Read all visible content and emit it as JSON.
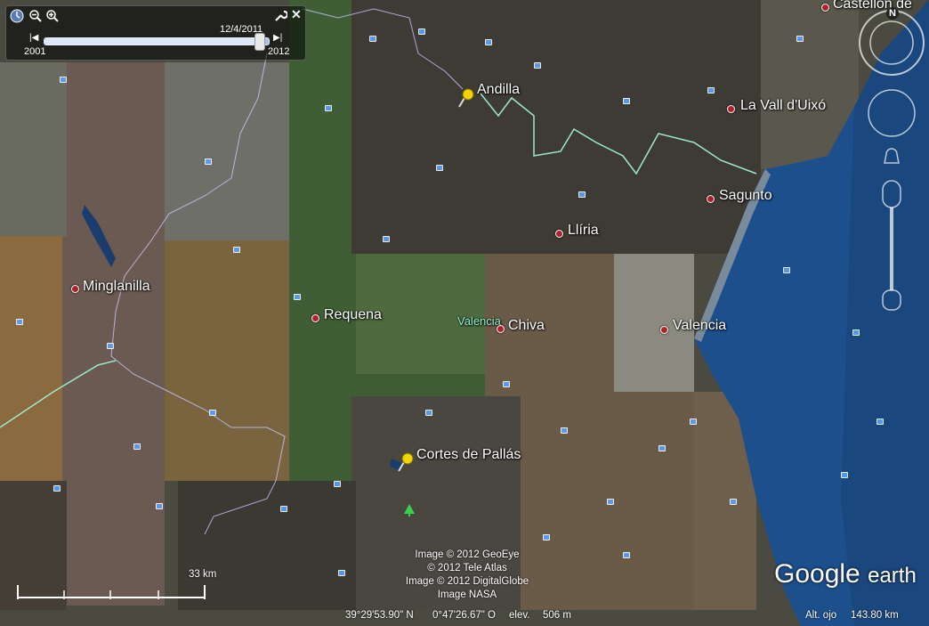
{
  "app": {
    "title": "Google Earth"
  },
  "time_slider": {
    "current_date": "12/4/2011",
    "start_year": "2001",
    "end_year": "2012",
    "position_fraction": 0.96
  },
  "places": {
    "castellon": "Castellón de",
    "andilla": "Andilla",
    "la_vall": "La Vall d'Uixó",
    "sagunto": "Sagunto",
    "lliria": "Llíria",
    "minglanilla": "Minglanilla",
    "requena": "Requena",
    "valencia_region": "Valencia",
    "chiva": "Chiva",
    "valencia": "Valencia",
    "cortes": "Cortes de Pallás"
  },
  "credits": [
    "Image © 2012 GeoEye",
    "© 2012 Tele Atlas",
    "Image © 2012 DigitalGlobe",
    "Image NASA"
  ],
  "scale": {
    "label": "33 km"
  },
  "status": {
    "lat": "39°29'53.90\" N",
    "lon": "0°47'26.67\" O",
    "elev_label": "elev.",
    "elev_value": "506 m",
    "eye_label": "Alt. ojo",
    "eye_value": "143.80 km"
  },
  "logo": {
    "google": "Google",
    "earth": "earth"
  },
  "nav": {
    "north": "N"
  },
  "colors": {
    "sea": "#1d4f8c",
    "border_line": "#9fe8d0",
    "city_dot": "#b0202a"
  }
}
